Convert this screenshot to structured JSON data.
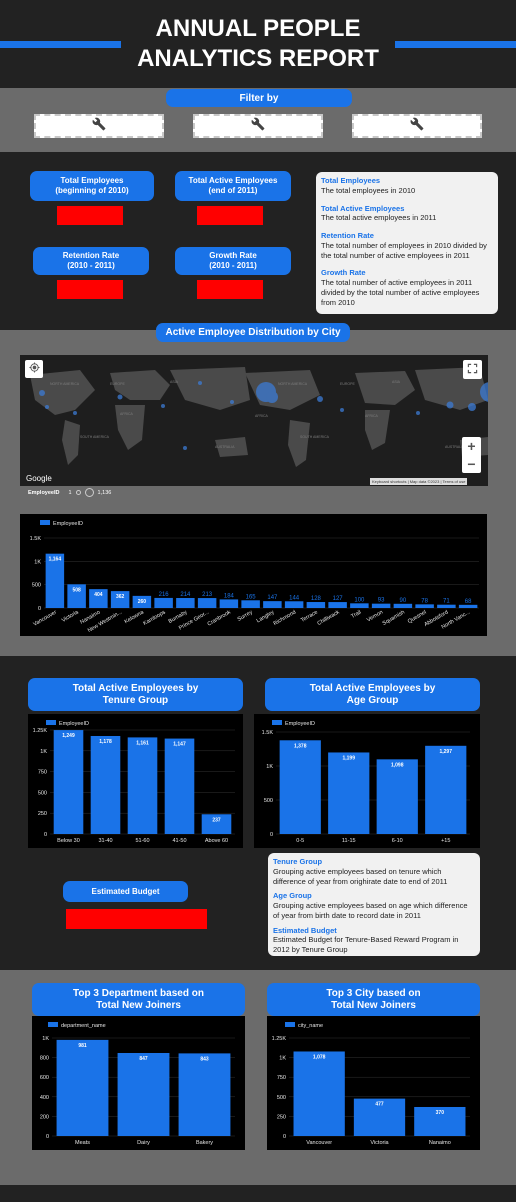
{
  "header": {
    "title_line1": "ANNUAL PEOPLE",
    "title_line2": "ANALYTICS REPORT"
  },
  "filter": {
    "label": "Filter by"
  },
  "kpi": {
    "total_employees_label": "Total Employees\n(beginning of 2010)",
    "active_employees_label": "Total Active Employees\n(end of 2011)",
    "retention_label": "Retention Rate\n(2010 - 2011)",
    "growth_label": "Growth Rate\n(2010 - 2011)"
  },
  "definitions": [
    {
      "title": "Total Employees",
      "text": "The total employees in 2010"
    },
    {
      "title": "Total  Active Employees",
      "text": "The total active employees in 2011"
    },
    {
      "title": "Retention Rate",
      "text": "The total number of employees in 2010 divided by the total number of active employees in 2011"
    },
    {
      "title": "Growth Rate",
      "text": "The total number of active employees in 2011 divided by the total number of active employees from 2010"
    }
  ],
  "map_section": {
    "title": "Active Employee Distribution by City",
    "google_label": "Google",
    "attribution": "Keyboard shortcuts | Map data ©2023 | Terms of use",
    "legend_field": "EmployeeID",
    "legend_min": "1",
    "legend_max": "1,136",
    "zoom_in": "+",
    "zoom_out": "−",
    "continents": [
      "NORTH AMERICA",
      "SOUTH AMERICA",
      "AFRICA",
      "EUROPE",
      "ASIA",
      "AUSTRALIA",
      "AFRICA",
      "SOUTH AMERICA",
      "NORTH AMERICA",
      "ASIA",
      "EUROPE",
      "AFRICA",
      "AUSTRALIA"
    ]
  },
  "tenure_section": {
    "title": "Total Active Employees by\nTenure Group"
  },
  "age_section": {
    "title": "Total Active Employees by\nAge Group"
  },
  "group_defs": [
    {
      "title": "Tenure Group",
      "text": "Grouping active employees based on tenure which difference of year from orighirate date to end of 2011"
    },
    {
      "title": "Age Group",
      "text": "Grouping active employees based on age which difference of year from birth date to record date in 2011"
    },
    {
      "title": "Estimated Budget",
      "text": "Estimated Budget for Tenure-Based Reward Program in 2012 by Tenure Group"
    }
  ],
  "budget": {
    "label": "Estimated Budget"
  },
  "dept_section": {
    "title": "Top 3 Department based on\nTotal New Joiners"
  },
  "city_section": {
    "title": "Top 3 City based on\nTotal New Joiners"
  },
  "colors": {
    "accent": "#1a73e8",
    "dark": "#222222",
    "grey": "#6b6b6b",
    "red": "#ff0000"
  },
  "icons": [
    "wrench-icon",
    "fullscreen-icon",
    "location-icon",
    "zoom-in-icon",
    "zoom-out-icon"
  ],
  "chart_data": [
    {
      "id": "city",
      "type": "bar",
      "series": [
        {
          "name": "EmployeeID",
          "values": [
            1164,
            508,
            404,
            362,
            260,
            216,
            214,
            213,
            184,
            165,
            147,
            144,
            128,
            127,
            100,
            93,
            90,
            78,
            71,
            68
          ]
        }
      ],
      "categories": [
        "Vancouver",
        "Victoria",
        "Nanaimo",
        "New Westmin...",
        "Kelowna",
        "Kamloops",
        "Burnaby",
        "Prince Geor...",
        "Cranbrook",
        "Surrey",
        "Langley",
        "Richmond",
        "Terrace",
        "Chilliwack",
        "Trail",
        "Vernon",
        "Squamish",
        "Quesnel",
        "Abbotsford",
        "North Vanc..."
      ],
      "yticks": [
        "0",
        "500",
        "1K",
        "1.5K"
      ],
      "ylim": [
        0,
        1500
      ]
    },
    {
      "id": "tenure",
      "type": "bar",
      "series": [
        {
          "name": "EmployeeID",
          "values": [
            1249,
            1178,
            1161,
            1147,
            237
          ]
        }
      ],
      "categories": [
        "Below 30",
        "31-40",
        "51-60",
        "41-50",
        "Above 60"
      ],
      "yticks": [
        "0",
        "250",
        "500",
        "750",
        "1K",
        "1.25K"
      ],
      "ylim": [
        0,
        1250
      ]
    },
    {
      "id": "age",
      "type": "bar",
      "series": [
        {
          "name": "EmployeeID",
          "values": [
            1378,
            1199,
            1098,
            1297
          ]
        }
      ],
      "categories": [
        "0-5",
        "11-15",
        "6-10",
        "+15"
      ],
      "yticks": [
        "0",
        "500",
        "1K",
        "1.5K"
      ],
      "ylim": [
        0,
        1500
      ]
    },
    {
      "id": "dept",
      "type": "bar",
      "series": [
        {
          "name": "department_name",
          "values": [
            981,
            847,
            843
          ]
        }
      ],
      "categories": [
        "Meats",
        "Dairy",
        "Bakery"
      ],
      "yticks": [
        "0",
        "200",
        "400",
        "600",
        "800",
        "1K"
      ],
      "ylim": [
        0,
        1000
      ]
    },
    {
      "id": "topcity",
      "type": "bar",
      "series": [
        {
          "name": "city_name",
          "values": [
            1078,
            477,
            370
          ]
        }
      ],
      "categories": [
        "Vancouver",
        "Victoria",
        "Nanaimo"
      ],
      "yticks": [
        "0",
        "250",
        "500",
        "750",
        "1K",
        "1.25K"
      ],
      "ylim": [
        0,
        1250
      ]
    }
  ]
}
